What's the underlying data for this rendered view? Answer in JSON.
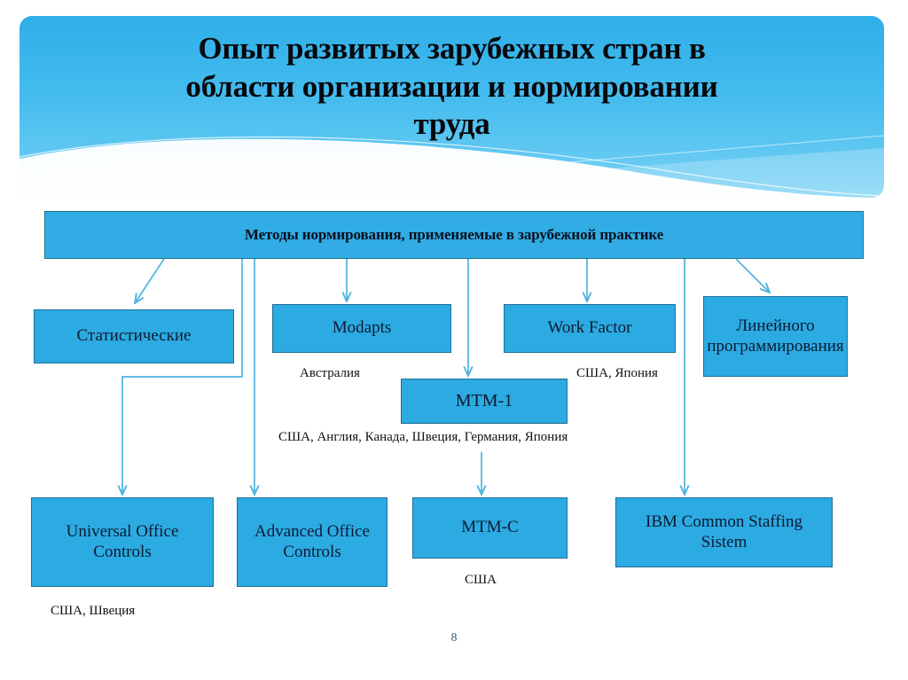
{
  "slide": {
    "page_number": "8",
    "accent_blue": "#2CAAE2",
    "node_border": "#1F6F93",
    "connector_color": "#4FB3DE",
    "header_gradient_top": "#2FAEE8",
    "header_gradient_bottom": "#7FD3F5",
    "caption_color": "#111111",
    "page_number_color": "#3b5770"
  },
  "header": {
    "title_lines": [
      "Опыт развитых зарубежных стран в",
      "области организации и нормировании",
      "труда"
    ]
  },
  "diagram": {
    "root": {
      "label": "Методы нормирования, применяемые в зарубежной практике"
    },
    "level2": [
      {
        "id": "statistical",
        "label": "Статистические"
      },
      {
        "id": "modapts",
        "label": "Modapts"
      },
      {
        "id": "work-factor",
        "label": "Work Factor"
      },
      {
        "id": "linear-programming",
        "label": "Линейного программирования"
      }
    ],
    "level3": [
      {
        "id": "mtm-1",
        "label": "MTM-1"
      }
    ],
    "leaves": [
      {
        "id": "universal-office-controls",
        "label": "Universal Office Controls"
      },
      {
        "id": "advanced-office-controls",
        "label": "Advanced Office Controls"
      },
      {
        "id": "mtm-c",
        "label": "MTM-C"
      },
      {
        "id": "ibm-common-staffing-sistem",
        "label": "IBM Common Staffing Sistem"
      }
    ],
    "captions": [
      {
        "id": "caption-modapts",
        "text": "Австралия"
      },
      {
        "id": "caption-work-factor",
        "text": "США, Япония"
      },
      {
        "id": "caption-mtm-1",
        "text": "США, Англия, Канада, Швеция, Германия, Япония"
      },
      {
        "id": "caption-universal-office-controls",
        "text": "США, Швеция"
      },
      {
        "id": "caption-mtm-c",
        "text": "США"
      }
    ]
  }
}
